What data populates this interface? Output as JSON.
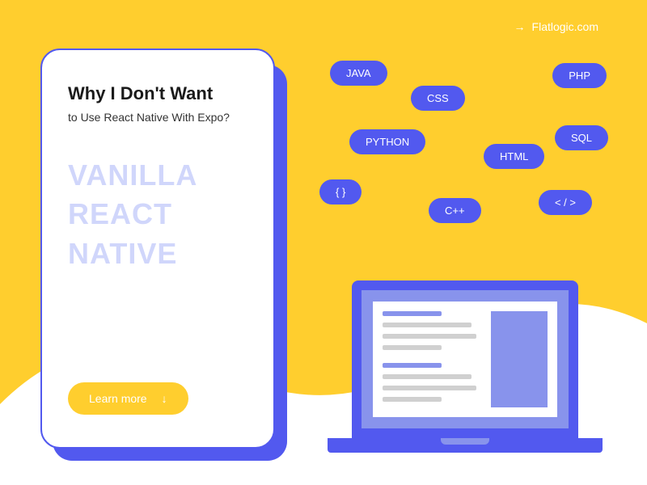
{
  "attribution": {
    "arrow": "→",
    "text": "Flatlogic.com"
  },
  "card": {
    "title": "Why I Don't Want",
    "subtitle": "to Use React Native With Expo?",
    "vanilla_line1": "VANILLA",
    "vanilla_line2": "REACT",
    "vanilla_line3": "NATIVE",
    "cta_label": "Learn more",
    "cta_icon": "↓"
  },
  "pills": {
    "java": "JAVA",
    "css": "CSS",
    "php": "PHP",
    "python": "PYTHON",
    "html": "HTML",
    "sql": "SQL",
    "braces": "{ }",
    "cpp": "C++",
    "closetag": "< / >"
  }
}
